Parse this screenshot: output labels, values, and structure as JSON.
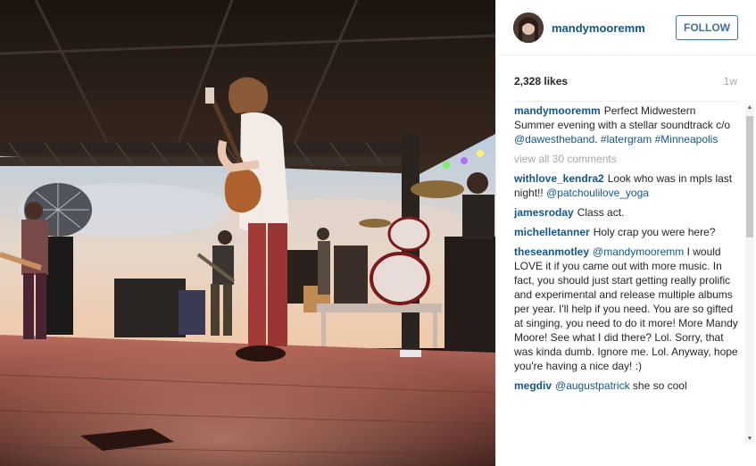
{
  "photo": {
    "alt": "concert stage photo"
  },
  "header": {
    "username": "mandymooremm",
    "follow_label": "FOLLOW"
  },
  "stats": {
    "likes": "2,328 likes",
    "age": "1w"
  },
  "caption": {
    "user": "mandymooremm",
    "text_1": "Perfect Midwestern Summer evening with a stellar soundtrack c/o ",
    "mention_1": "@dawestheband",
    "text_2": ". ",
    "tag_1": "#latergram",
    "text_3": " ",
    "tag_2": "#Minneapolis"
  },
  "view_all": "view all 30 comments",
  "comments": [
    {
      "user": "withlove_kendra2",
      "text_a": "Look who was in mpls last night!! ",
      "mention": "@patchoulilove_yoga",
      "text_b": ""
    },
    {
      "user": "jamesroday",
      "text_a": "Class act.",
      "mention": "",
      "text_b": ""
    },
    {
      "user": "michelletanner",
      "text_a": "Holy crap you were here?",
      "mention": "",
      "text_b": ""
    },
    {
      "user": "theseanmotley",
      "text_a": "",
      "mention": "@mandymooremm",
      "text_b": " I would LOVE it if you came out with more music. In fact, you should just start getting really prolific and experimental and release multiple albums per year. I'll help if you need. You are so gifted at singing, you need to do it more! More Mandy Moore! See what I did there? Lol. Sorry, that was kinda dumb. Ignore me. Lol. Anyway, hope you're having a nice day! :)"
    },
    {
      "user": "megdiv",
      "text_a": "",
      "mention": "@augustpatrick",
      "text_b": " she so cool"
    }
  ],
  "colors": {
    "link": "#125688",
    "muted": "#a5a7aa",
    "text": "#262626"
  },
  "icons": {
    "scroll_up": "triangle-up-icon",
    "scroll_down": "triangle-down-icon"
  }
}
